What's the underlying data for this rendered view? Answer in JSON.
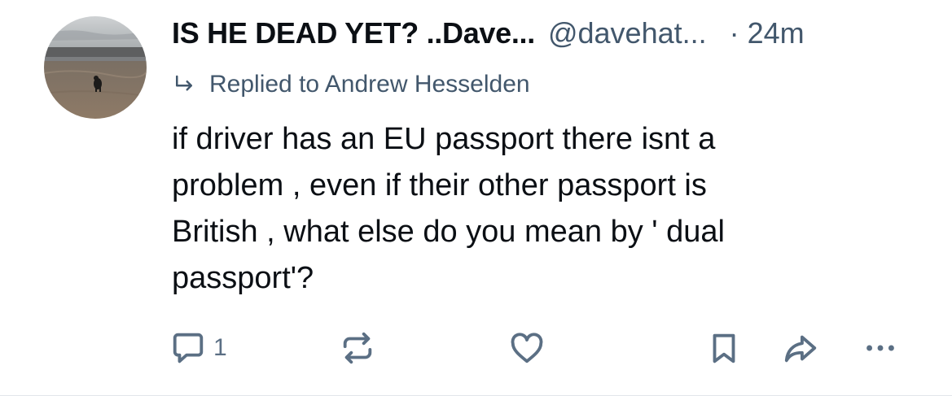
{
  "post": {
    "display_name": "IS HE DEAD YET? ..Dave...",
    "handle": "@davehat...",
    "separator": "·",
    "time": "24m",
    "reply_to_text": "Replied to Andrew Hesselden",
    "body_lines": [
      "if driver has an EU passport there isnt a",
      "problem , even if their other passport is",
      "British , what else do you mean by ' dual",
      "passport'?"
    ]
  },
  "actions": {
    "reply_count": "1",
    "icons": [
      "reply-icon",
      "repost-icon",
      "like-icon",
      "bookmark-icon",
      "share-icon",
      "more-icon"
    ]
  },
  "colors": {
    "text_primary": "#0b0f14",
    "text_secondary": "#42576c",
    "icon": "#5b6f84"
  }
}
